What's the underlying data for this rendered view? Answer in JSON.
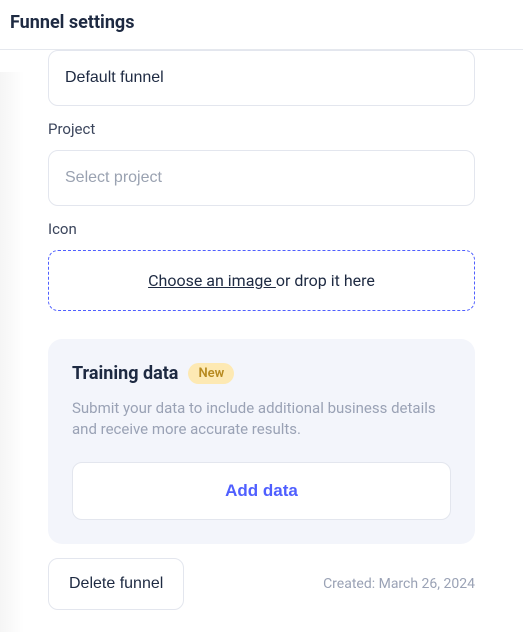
{
  "header": {
    "title": "Funnel settings"
  },
  "fields": {
    "name_value": "Default funnel",
    "project_label": "Project",
    "project_placeholder": "Select project",
    "icon_label": "Icon",
    "dropzone_link": "Choose an image ",
    "dropzone_suffix": "or drop it here"
  },
  "training_card": {
    "title": "Training data",
    "badge": "New",
    "description": "Submit your data to include additional business details and receive more accurate results.",
    "button": "Add data"
  },
  "footer": {
    "delete_label": "Delete funnel",
    "created_prefix": "Created: ",
    "created_date": "March 26, 2024"
  }
}
